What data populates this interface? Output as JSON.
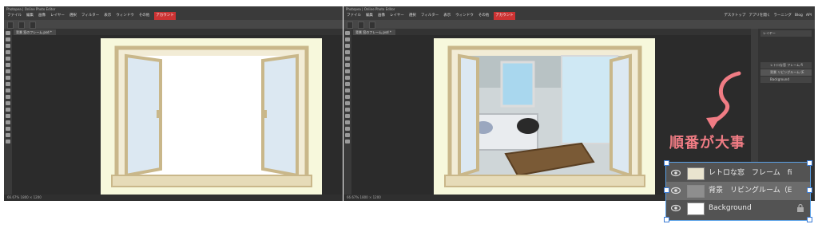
{
  "app": {
    "title": "Photopea | Online Photo Editor",
    "menu": [
      "ファイル",
      "編集",
      "画像",
      "レイヤー",
      "選択",
      "フィルター",
      "表示",
      "ウィンドウ",
      "その他"
    ],
    "account_label": "アカウント",
    "right_links": [
      "デスクトップ",
      "アプリを開く",
      "ラーニング",
      "Blog",
      "API"
    ]
  },
  "left_screen": {
    "tab_label": "背景 窓のフレーム.psd *",
    "status": "66.67%  1800 × 1200"
  },
  "right_screen": {
    "tab_label": "背景 窓のフレーム.psd *",
    "status": "66.67%  1800 × 1200",
    "layers_title": "レイヤー",
    "layers": [
      "レトロな窓 フレーム fi",
      "背景 リビングルーム (E",
      "Background"
    ]
  },
  "annotation": {
    "text": "順番が大事",
    "color": "#f07c84"
  },
  "layers_zoom": {
    "rows": [
      {
        "label": "レトロな窓　フレーム　fi"
      },
      {
        "label": "背景　リビングルーム（E"
      },
      {
        "label": "Background"
      }
    ]
  }
}
